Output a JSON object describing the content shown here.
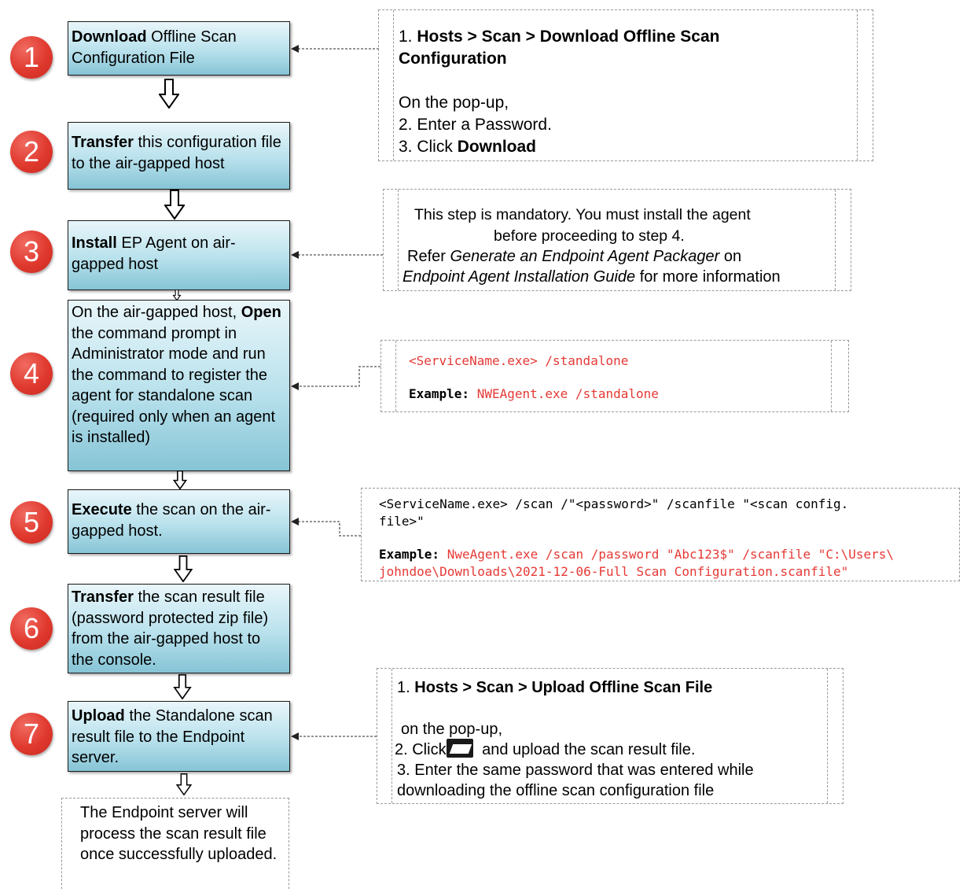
{
  "steps": [
    {
      "num": "1",
      "bold": "Download",
      "rest": " Offline Scan Configuration File"
    },
    {
      "num": "2",
      "bold": "Transfer",
      "rest": " this configuration file to the air-gapped host"
    },
    {
      "num": "3",
      "bold": "Install",
      "rest": " EP Agent on air-gapped host"
    },
    {
      "num": "4",
      "pre": "On the air-gapped host, ",
      "bold": "Open",
      "rest": " the command prompt in Administrator mode and run the command to register the agent for standalone scan (required only when an agent is installed)"
    },
    {
      "num": "5",
      "bold": "Execute",
      "rest": " the scan on the air-gapped host."
    },
    {
      "num": "6",
      "bold": "Transfer",
      "rest": " the scan result file (password protected zip file) from the air-gapped host to the console."
    },
    {
      "num": "7",
      "bold": "Upload",
      "rest": " the Standalone scan result file to the Endpoint server."
    }
  ],
  "final_note": "The Endpoint server will process the scan result file once successfully uploaded.",
  "note1": {
    "line1_prefix": "1. ",
    "line1_bold": "Hosts > Scan > Download Offline Scan",
    "line2_bold": "Configuration",
    "line3": "On the pop-up,",
    "line4": "2. Enter a Password.",
    "line5_prefix": "3. Click ",
    "line5_bold": "Download"
  },
  "note3": {
    "line1": "This step is mandatory. You must install the agent",
    "line2": "before proceeding to step 4.",
    "line3_prefix": "Refer ",
    "line3_italic": "Generate an Endpoint Agent Packager",
    "line3_suffix": " on",
    "line4_italic": "Endpoint Agent Installation Guide",
    "line4_suffix": " for more information"
  },
  "note4": {
    "cmd": "<ServiceName.exe> /standalone",
    "example_label": "Example:",
    "example_cmd": "NWEAgent.exe /standalone"
  },
  "note5": {
    "cmd_line1": " <ServiceName.exe> /scan /\"<password>\" /scanfile \"<scan config.",
    "cmd_line2": "file>\"",
    "example_label": "Example:",
    "example_line1": "NweAgent.exe /scan /password \"Abc123$\" /scanfile \"C:\\Users\\",
    "example_line2": "johndoe\\Downloads\\2021-12-06-Full Scan Configuration.scanfile\""
  },
  "note7": {
    "line1_prefix": "1. ",
    "line1_bold": "Hosts > Scan > Upload Offline Scan File",
    "line2": "on the pop-up,",
    "line3_prefix": "2. Click",
    "line3_suffix": " and upload the scan result file.",
    "line4": "3. Enter the same password that was entered while",
    "line5": "downloading the offline scan configuration file",
    "icon": "folder-open-icon"
  },
  "colors": {
    "circle": "#e0392e",
    "box_top": "#e9f6fa",
    "box_bottom": "#86c4d6",
    "code_red": "#e53935"
  }
}
